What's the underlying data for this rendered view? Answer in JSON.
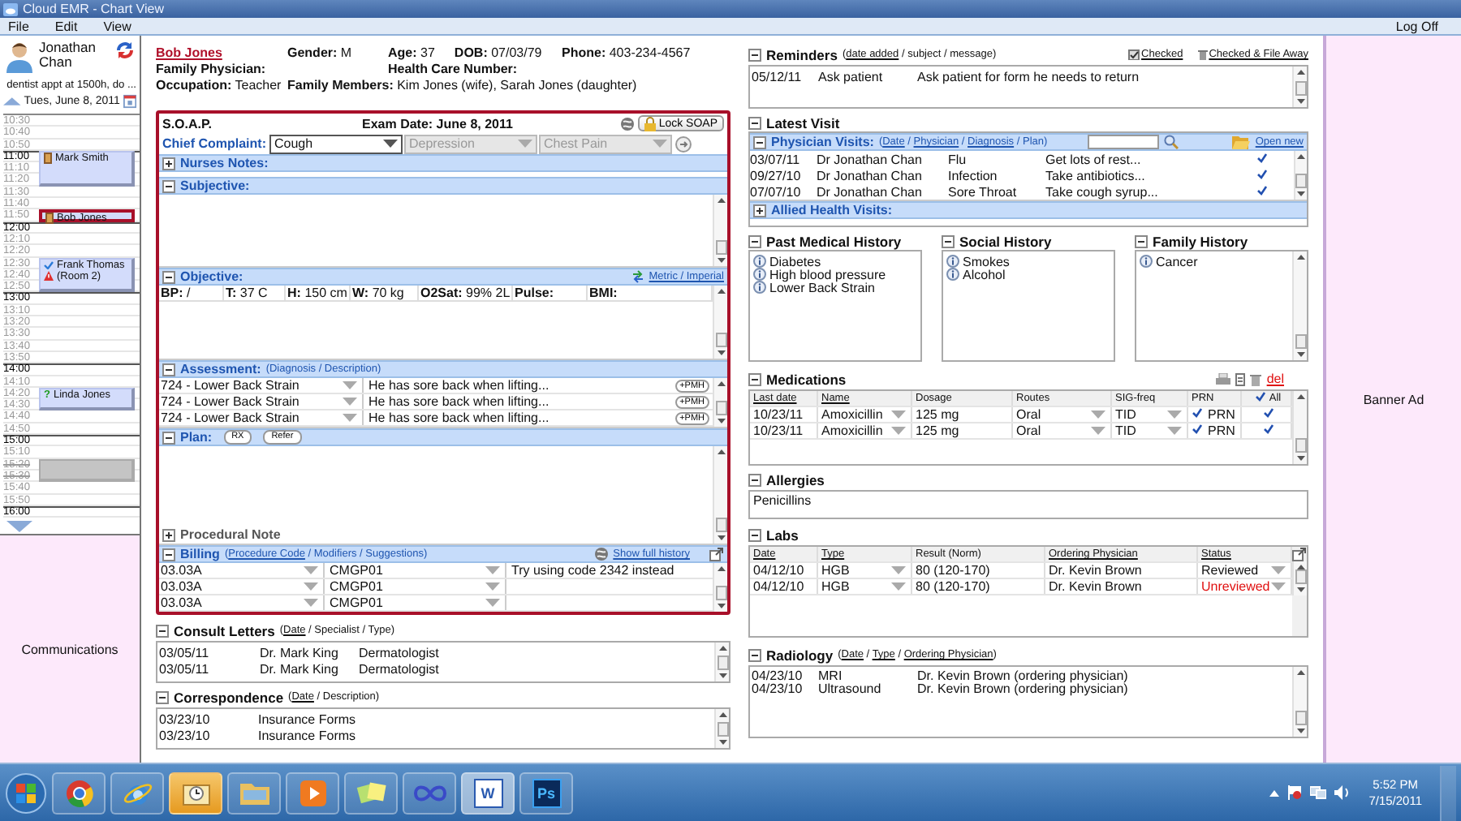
{
  "window": {
    "title": "Cloud EMR - Chart View"
  },
  "menu": [
    {
      "label": "File"
    },
    {
      "label": "Edit"
    },
    {
      "label": "View"
    }
  ],
  "log_off": "Log Off",
  "schedule": {
    "provider": "Jonathan Chan",
    "note": "dentist appt at 1500h, do ...",
    "date": "Tues, June 8, 2011",
    "slots": [
      {
        "time": "10:30",
        "kind": "minute"
      },
      {
        "time": "10:40",
        "kind": "minute"
      },
      {
        "time": "10:50",
        "kind": "minute"
      },
      {
        "time": "11:00",
        "kind": "hour",
        "appointment": {
          "name": "Mark Smith",
          "kind": "arrived",
          "selected": false
        }
      },
      {
        "time": "11:10",
        "kind": "minute",
        "continued": true
      },
      {
        "time": "11:20",
        "kind": "minute",
        "continued": true
      },
      {
        "time": "11:30",
        "kind": "minute"
      },
      {
        "time": "11:40",
        "kind": "minute"
      },
      {
        "time": "11:50",
        "kind": "minute",
        "appointment": {
          "name": "Bob Jones",
          "kind": "arrived",
          "selected": true
        }
      },
      {
        "time": "12:00",
        "kind": "hour"
      },
      {
        "time": "12:10",
        "kind": "minute"
      },
      {
        "time": "12:20",
        "kind": "minute"
      },
      {
        "time": "12:30",
        "kind": "minute",
        "appointment": {
          "name": "Frank Thomas (Room 2)",
          "kind": "alert",
          "selected": false
        }
      },
      {
        "time": "12:40",
        "kind": "minute",
        "continued": true
      },
      {
        "time": "12:50",
        "kind": "minute",
        "continued": true
      },
      {
        "time": "13:00",
        "kind": "hour"
      },
      {
        "time": "13:10",
        "kind": "minute"
      },
      {
        "time": "13:20",
        "kind": "minute"
      },
      {
        "time": "13:30",
        "kind": "minute"
      },
      {
        "time": "13:40",
        "kind": "minute"
      },
      {
        "time": "13:50",
        "kind": "minute"
      },
      {
        "time": "14:00",
        "kind": "hour"
      },
      {
        "time": "14:10",
        "kind": "minute"
      },
      {
        "time": "14:20",
        "kind": "minute",
        "appointment": {
          "name": "Linda Jones",
          "kind": "unconfirmed",
          "mark": "?",
          "selected": false
        }
      },
      {
        "time": "14:30",
        "kind": "minute",
        "continued": true
      },
      {
        "time": "14:40",
        "kind": "minute"
      },
      {
        "time": "14:50",
        "kind": "minute"
      },
      {
        "time": "15:00",
        "kind": "hour"
      },
      {
        "time": "15:10",
        "kind": "minute"
      },
      {
        "time": "15:20",
        "kind": "blocked",
        "appointment": {
          "kind": "blocked",
          "selected": false
        }
      },
      {
        "time": "15:30",
        "kind": "blocked",
        "continued": true
      },
      {
        "time": "15:40",
        "kind": "minute"
      },
      {
        "time": "15:50",
        "kind": "minute"
      },
      {
        "time": "16:00",
        "kind": "hour"
      }
    ]
  },
  "communications": "Communications",
  "patient": {
    "name": "Bob Jones",
    "gender": {
      "label": "Gender:",
      "value": "M"
    },
    "age": {
      "label": "Age:",
      "value": "37"
    },
    "dob": {
      "label": "DOB:",
      "value": "07/03/79"
    },
    "phone": {
      "label": "Phone:",
      "value": "403-234-4567"
    },
    "family_physician": {
      "label": "Family Physician:"
    },
    "health_care_number": {
      "label": "Health Care Number:"
    },
    "occupation": {
      "label": "Occupation:",
      "value": "Teacher"
    },
    "family_members": {
      "label": "Family Members:",
      "value": "Kim Jones (wife), Sarah Jones (daughter)"
    }
  },
  "soap": {
    "title": "S.O.A.P.",
    "exam_date": "Exam Date: June 8, 2011",
    "lock_button": "Lock SOAP",
    "chief_complaint": {
      "label": "Chief Complaint:",
      "fields": [
        {
          "value": "Cough",
          "disabled": false
        },
        {
          "value": "Depression",
          "disabled": true
        },
        {
          "value": "Chest Pain",
          "disabled": true
        }
      ]
    },
    "nurses_notes": {
      "title": "Nurses Notes:",
      "expanded": false
    },
    "subjective": {
      "title": "Subjective:",
      "expanded": true
    },
    "objective": {
      "title": "Objective:",
      "expanded": true,
      "link": "Metric / Imperial",
      "vitals": [
        {
          "label": "BP:",
          "value": "/"
        },
        {
          "label": "T:",
          "value": "37 C"
        },
        {
          "label": "H:",
          "value": "150 cm"
        },
        {
          "label": "W:",
          "value": "70 kg"
        },
        {
          "label": "O2Sat:",
          "value": "99% 2L"
        },
        {
          "label": "Pulse:"
        },
        {
          "label": "BMI:"
        }
      ]
    },
    "assessment": {
      "title": "Assessment:",
      "expanded": true,
      "hint": [
        {
          "text": "(Diagnosis / Description)",
          "link": false
        }
      ],
      "rows": [
        {
          "diagnosis": "724 - Lower Back Strain",
          "description": "He has sore back when lifting...",
          "button": "+PMH"
        },
        {
          "diagnosis": "724 - Lower Back Strain",
          "description": "He has sore back when lifting...",
          "button": "+PMH"
        },
        {
          "diagnosis": "724 - Lower Back Strain",
          "description": "He has sore back when lifting...",
          "button": "+PMH"
        }
      ]
    },
    "plan": {
      "title": "Plan:",
      "expanded": true,
      "buttons": [
        "RX",
        "Refer"
      ],
      "procedural_note": {
        "title": "Procedural Note",
        "expanded": false
      }
    },
    "billing": {
      "title": "Billing",
      "expanded": true,
      "hint": [
        {
          "text": "(",
          "link": false
        },
        {
          "text": "Procedure Code",
          "link": true
        },
        {
          "text": " / Modifiers / Suggestions)",
          "link": false
        }
      ],
      "history_link": "Show full history",
      "rows": [
        {
          "code": "03.03A",
          "modifier": "CMGP01",
          "suggestion": "Try using code 2342 instead"
        },
        {
          "code": "03.03A",
          "modifier": "CMGP01"
        },
        {
          "code": "03.03A",
          "modifier": "CMGP01"
        }
      ]
    }
  },
  "consult_letters": {
    "title": "Consult Letters",
    "expanded": true,
    "hint": [
      {
        "text": "(",
        "link": false
      },
      {
        "text": "Date",
        "link": true
      },
      {
        "text": " / Specialist / Type)",
        "link": false
      }
    ],
    "rows": [
      {
        "date": "03/05/11",
        "specialist": "Dr. Mark King",
        "type": "Dermatologist"
      },
      {
        "date": "03/05/11",
        "specialist": "Dr. Mark King",
        "type": "Dermatologist"
      }
    ]
  },
  "correspondence": {
    "title": "Correspondence",
    "expanded": true,
    "hint": [
      {
        "text": "(",
        "link": false
      },
      {
        "text": "Date",
        "link": true
      },
      {
        "text": " / Description)",
        "link": false
      }
    ],
    "rows": [
      {
        "date": "03/23/10",
        "description": "Insurance Forms"
      },
      {
        "date": "03/23/10",
        "description": "Insurance Forms"
      }
    ]
  },
  "reminders": {
    "title": "Reminders",
    "expanded": true,
    "hint": [
      {
        "text": "(",
        "link": false
      },
      {
        "text": "date added",
        "link": true
      },
      {
        "text": " / subject / message)",
        "link": false
      }
    ],
    "actions": [
      {
        "label": "Checked",
        "kind": "check"
      },
      {
        "label": "Checked & File Away",
        "kind": "trash"
      }
    ],
    "rows": [
      {
        "date": "05/12/11",
        "subject": "Ask patient",
        "message": "Ask patient for form he needs to return"
      }
    ]
  },
  "latest_visit": {
    "title": "Latest Visit",
    "expanded": true,
    "physician_visits": {
      "title": "Physician Visits:",
      "expanded": true,
      "hint": [
        {
          "text": "(",
          "link": false
        },
        {
          "text": "Date",
          "link": true
        },
        {
          "text": " / ",
          "link": false
        },
        {
          "text": "Physician",
          "link": true
        },
        {
          "text": " / ",
          "link": false
        },
        {
          "text": "Diagnosis",
          "link": true
        },
        {
          "text": " / Plan)",
          "link": false
        }
      ],
      "open_new": "Open new",
      "rows": [
        {
          "date": "03/07/11",
          "physician": "Dr Jonathan Chan",
          "diagnosis": "Flu",
          "plan": "Get lots of rest...",
          "checked": true
        },
        {
          "date": "09/27/10",
          "physician": "Dr Jonathan Chan",
          "diagnosis": "Infection",
          "plan": "Take antibiotics...",
          "checked": true
        },
        {
          "date": "07/07/10",
          "physician": "Dr Jonathan Chan",
          "diagnosis": "Sore Throat",
          "plan": "Take cough syrup...",
          "checked": true
        }
      ]
    },
    "allied_health_visits": {
      "title": "Allied Health Visits:",
      "expanded": false
    }
  },
  "histories": [
    {
      "title": "Past Medical History",
      "expanded": true,
      "items": [
        "Diabetes",
        "High blood pressure",
        "Lower Back Strain"
      ]
    },
    {
      "title": "Social History",
      "expanded": true,
      "items": [
        "Smokes",
        "Alcohol"
      ]
    },
    {
      "title": "Family History",
      "expanded": true,
      "items": [
        "Cancer"
      ]
    }
  ],
  "medications": {
    "title": "Medications",
    "expanded": true,
    "delete_link": "del",
    "columns": [
      {
        "label": "Last date",
        "link": true
      },
      {
        "label": "Name",
        "link": true
      },
      {
        "label": "Dosage",
        "link": false
      },
      {
        "label": "Routes",
        "link": false
      },
      {
        "label": "SIG-freq",
        "link": false
      },
      {
        "label": "PRN",
        "link": false
      }
    ],
    "all": {
      "label": "All",
      "checked": true
    },
    "rows": [
      {
        "date": "10/23/11",
        "name": "Amoxicillin",
        "dosage": "125 mg",
        "route": "Oral",
        "frequency": "TID",
        "prn": {
          "label": "PRN",
          "checked": true
        },
        "checked": true
      },
      {
        "date": "10/23/11",
        "name": "Amoxicillin",
        "dosage": "125 mg",
        "route": "Oral",
        "frequency": "TID",
        "prn": {
          "label": "PRN",
          "checked": true
        },
        "checked": true
      }
    ]
  },
  "allergies": {
    "title": "Allergies",
    "expanded": true,
    "text": "Penicillins"
  },
  "labs": {
    "title": "Labs",
    "expanded": true,
    "columns": [
      {
        "label": "Date",
        "link": true
      },
      {
        "label": "Type",
        "link": true
      },
      {
        "label": "Result (Norm)",
        "link": false
      },
      {
        "label": "Ordering Physician",
        "link": true
      },
      {
        "label": "Status",
        "link": true
      }
    ],
    "rows": [
      {
        "date": "04/12/10",
        "type": "HGB",
        "result": "80 (120-170)",
        "physician": "Dr. Kevin Brown",
        "status": "Reviewed",
        "reviewed": true
      },
      {
        "date": "04/12/10",
        "type": "HGB",
        "result": "80 (120-170)",
        "physician": "Dr. Kevin Brown",
        "status": "Unreviewed",
        "reviewed": false
      }
    ]
  },
  "radiology": {
    "title": "Radiology",
    "expanded": true,
    "hint": [
      {
        "text": "(",
        "link": false
      },
      {
        "text": "Date",
        "link": true
      },
      {
        "text": " / ",
        "link": false
      },
      {
        "text": "Type",
        "link": true
      },
      {
        "text": " / ",
        "link": false
      },
      {
        "text": "Ordering Physician",
        "link": true
      },
      {
        "text": ")",
        "link": false
      }
    ],
    "rows": [
      {
        "date": "04/23/10",
        "type": "MRI",
        "physician": "Dr. Kevin Brown (ordering physician)"
      },
      {
        "date": "04/23/10",
        "type": "Ultrasound",
        "physician": "Dr. Kevin Brown (ordering physician)"
      }
    ]
  },
  "banner": "Banner Ad",
  "taskbar": {
    "apps": [
      {
        "kind": "chrome",
        "selected": false,
        "attention": false
      },
      {
        "kind": "ie",
        "selected": false,
        "attention": false
      },
      {
        "kind": "outlook",
        "selected": false,
        "attention": true
      },
      {
        "kind": "explorer",
        "selected": false,
        "attention": false
      },
      {
        "kind": "media",
        "selected": false,
        "attention": false
      },
      {
        "kind": "notes",
        "selected": false,
        "attention": false
      },
      {
        "kind": "loop",
        "selected": false,
        "attention": false
      },
      {
        "kind": "word",
        "label": "W",
        "selected": true,
        "attention": false
      },
      {
        "kind": "photoshop",
        "label": "Ps",
        "selected": false,
        "attention": false
      }
    ],
    "time": "5:52 PM",
    "date": "7/15/2011"
  }
}
